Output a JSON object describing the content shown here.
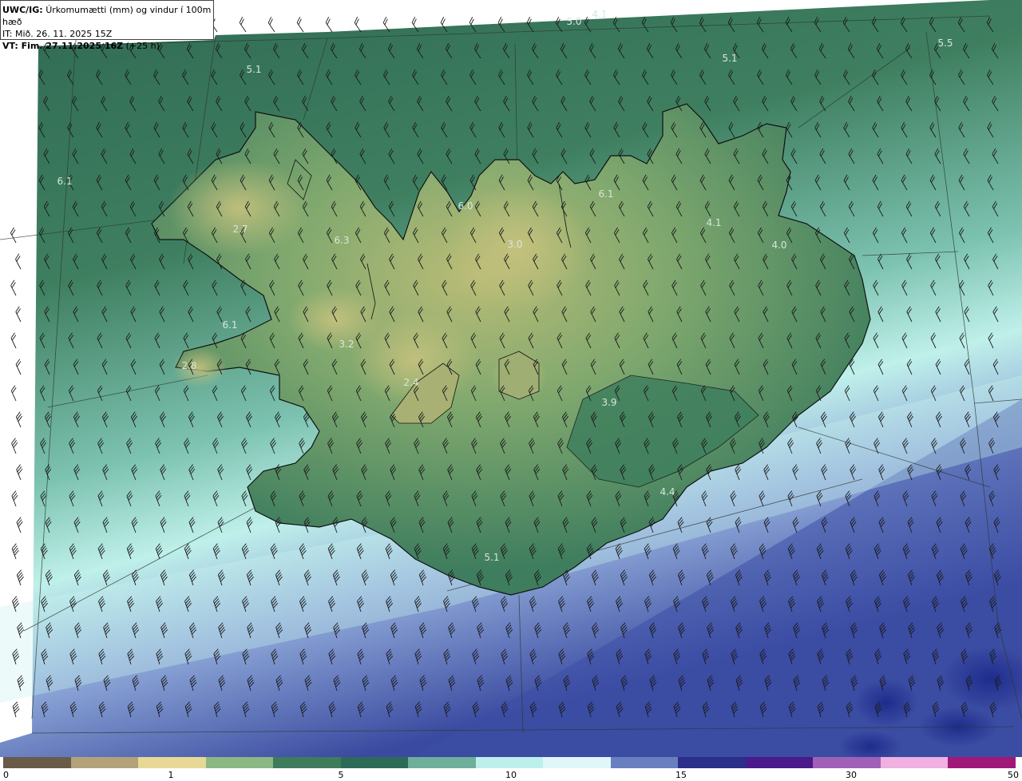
{
  "header": {
    "product_bold": "UWC/IG:",
    "product_desc": "Úrkomumætti (mm) og vindur í 100m hæð",
    "init_time": "IT: Mið. 26. 11. 2025 15Z",
    "valid_bold": "VT: Fim. 27.11.2025 16Z",
    "valid_lead": "(+25 h)"
  },
  "map_labels": [
    {
      "id": "a",
      "text": "5.0"
    },
    {
      "id": "b",
      "text": "4.1"
    },
    {
      "id": "c",
      "text": "5.5"
    },
    {
      "id": "d",
      "text": "5.1"
    },
    {
      "id": "e",
      "text": "5.1"
    },
    {
      "id": "f",
      "text": "6.1"
    },
    {
      "id": "g",
      "text": "2.7"
    },
    {
      "id": "h",
      "text": "6.3"
    },
    {
      "id": "i",
      "text": "6.0"
    },
    {
      "id": "j",
      "text": "3.0"
    },
    {
      "id": "k",
      "text": "6.1"
    },
    {
      "id": "l",
      "text": "4.1"
    },
    {
      "id": "m",
      "text": "4.0"
    },
    {
      "id": "n",
      "text": "6.1"
    },
    {
      "id": "o",
      "text": "3.2"
    },
    {
      "id": "p",
      "text": "2.8"
    },
    {
      "id": "q",
      "text": "2.4"
    },
    {
      "id": "r",
      "text": "3.9"
    },
    {
      "id": "s",
      "text": "4.4"
    },
    {
      "id": "t",
      "text": "5.1"
    }
  ],
  "colorbar": {
    "ticks": [
      "0",
      "1",
      "5",
      "10",
      "15",
      "30",
      "50"
    ],
    "colors": [
      "#6a5a48",
      "#b2a27a",
      "#e7d895",
      "#8cb783",
      "#3f7c5b",
      "#2e6a58",
      "#6fae9a",
      "#bdf0ea",
      "#e0f7fa",
      "#6a7fc0",
      "#2a2f8a",
      "#4a1a8a",
      "#a060b8",
      "#f0b0e0",
      "#a01878"
    ],
    "background_colors": {
      "north": "#2f6a54",
      "land_high": "#c3c07a",
      "land_mid": "#5f9a6a",
      "coast_south": "#a4dcd4",
      "sea_south": "#3a4aa0"
    }
  }
}
